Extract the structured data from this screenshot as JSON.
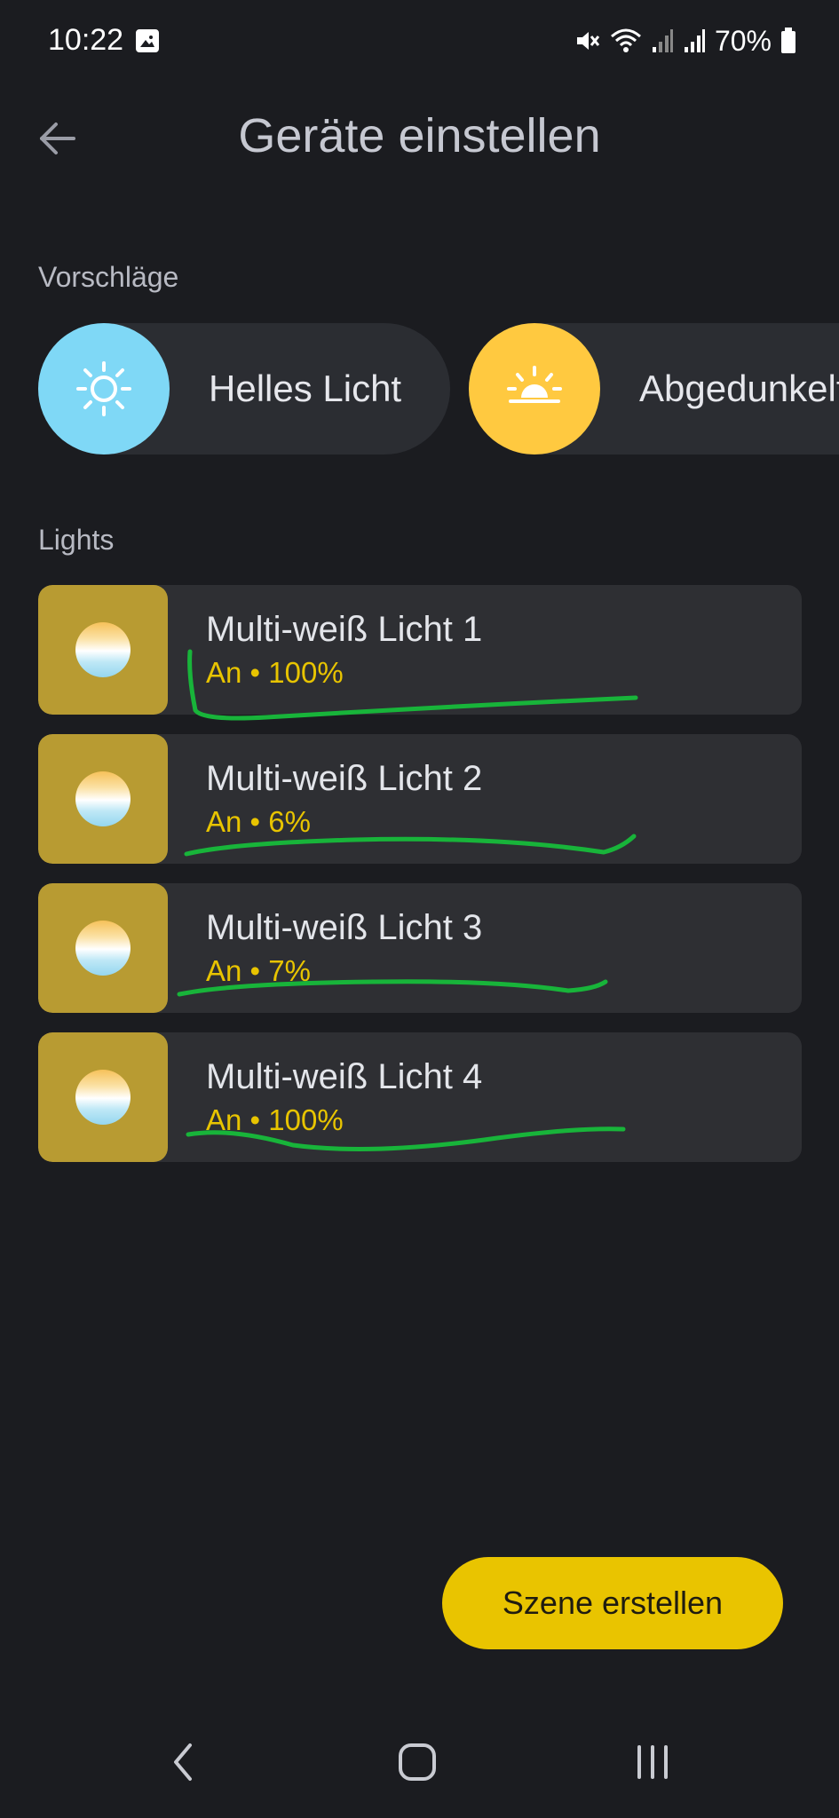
{
  "status_bar": {
    "time": "10:22",
    "battery": "70%",
    "icons": [
      "gallery-icon",
      "mute-icon",
      "wifi-icon",
      "signal-icon",
      "signal-icon",
      "battery-icon"
    ]
  },
  "header": {
    "title": "Geräte einstellen",
    "back_icon": "arrow-left-icon"
  },
  "suggestions": {
    "label": "Vorschläge",
    "items": [
      {
        "label": "Helles Licht",
        "icon": "sun-icon",
        "color": "#7fd8f6"
      },
      {
        "label": "Abgedunkelt",
        "icon": "sunrise-icon",
        "color": "#ffc940"
      }
    ]
  },
  "lights": {
    "label": "Lights",
    "items": [
      {
        "name": "Multi-weiß Licht 1",
        "status": "An • 100%"
      },
      {
        "name": "Multi-weiß Licht 2",
        "status": "An • 6%"
      },
      {
        "name": "Multi-weiß Licht 3",
        "status": "An • 7%"
      },
      {
        "name": "Multi-weiß Licht 4",
        "status": "An • 100%"
      }
    ]
  },
  "create_button": {
    "label": "Szene erstellen"
  },
  "nav": {
    "icons": [
      "nav-back-icon",
      "nav-home-icon",
      "nav-recents-icon"
    ]
  },
  "colors": {
    "background": "#1b1c20",
    "card": "#2e2f33",
    "accent": "#e9c400",
    "light_icon_bg": "#b89b32",
    "annotation": "#18b43a"
  }
}
